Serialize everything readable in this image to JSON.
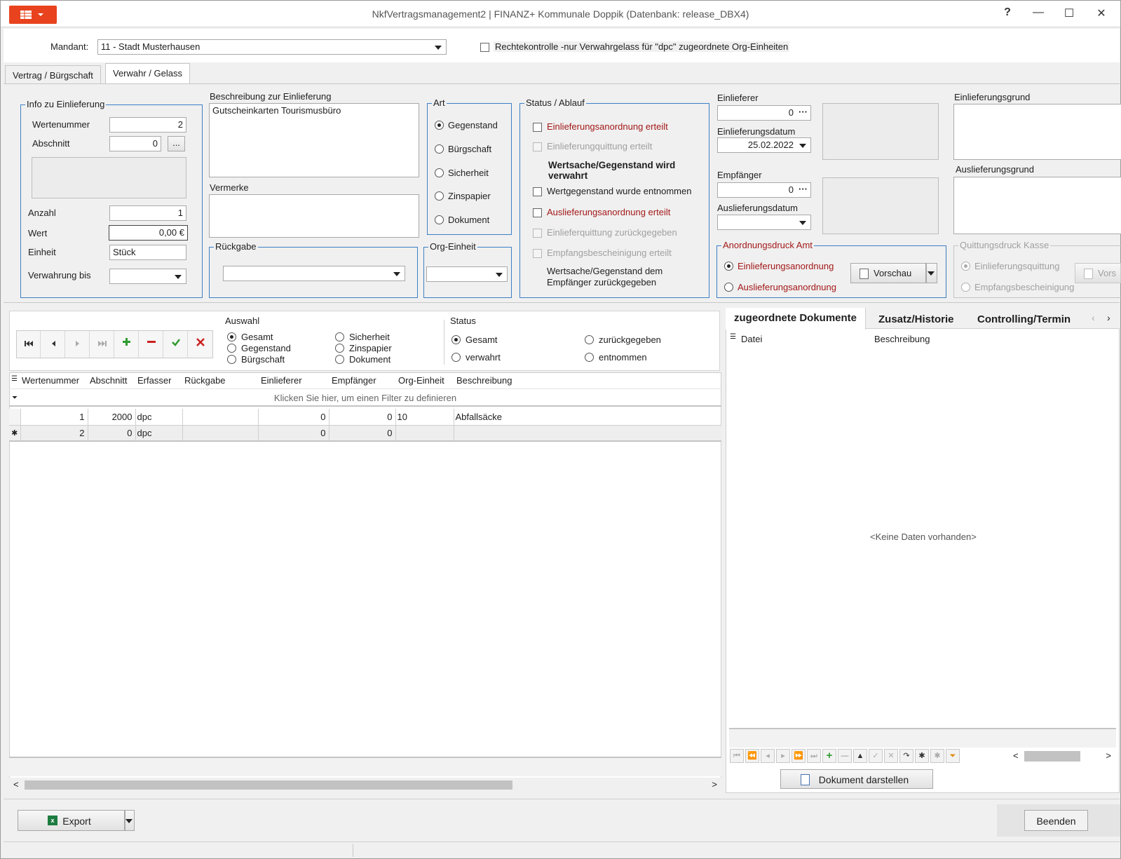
{
  "window": {
    "title": "NkfVertragsmanagement2 | FINANZ+ Kommunale Doppik (Datenbank: release_DBX4)",
    "help": "?",
    "minimize": "—",
    "maximize": "☐",
    "close": "✕"
  },
  "mandant": {
    "label": "Mandant:",
    "value": "11 - Stadt Musterhausen",
    "rechtekontrolle": "Rechtekontrolle  -nur Verwahrgelass für \"dpc\" zugeordnete Org-Einheiten"
  },
  "tabs": [
    "Vertrag / Bürgschaft",
    "Verwahr / Gelass"
  ],
  "info": {
    "title": "Info zu Einlieferung",
    "wertenummer_label": "Wertenummer",
    "wertenummer": "2",
    "abschnitt_label": "Abschnitt",
    "abschnitt": "0",
    "ellipsis": "...",
    "anzahl_label": "Anzahl",
    "anzahl": "1",
    "wert_label": "Wert",
    "wert": "0,00 €",
    "einheit_label": "Einheit",
    "einheit": "Stück",
    "verwahrung_label": "Verwahrung bis",
    "verwahrung": ""
  },
  "beschreibung": {
    "label": "Beschreibung zur Einlieferung",
    "value": "Gutscheinkarten Tourismusbüro",
    "vermerke_label": "Vermerke",
    "rueckgabe_label": "Rückgabe",
    "orgeinheit_label": "Org-Einheit"
  },
  "art": {
    "title": "Art",
    "options": [
      "Gegenstand",
      "Bürgschaft",
      "Sicherheit",
      "Zinspapier",
      "Dokument"
    ],
    "selected": "Gegenstand"
  },
  "status_ablauf": {
    "title": "Status / Ablauf",
    "einlieferungsanordnung": "Einlieferungsanordnung erteilt",
    "einlieferungquittung": "Einlieferungquittung erteilt",
    "verwahrt": "Wertsache/Gegenstand wird verwahrt",
    "entnommen": "Wertgegenstand wurde entnommen",
    "auslieferungsanordnung": "Auslieferungsanordnung erteilt",
    "einlieferquittung_zurueck": "Einlieferquittung zurückgegeben",
    "empfangsbescheinigung": "Empfangsbescheinigung erteilt",
    "zurueckgegeben": "Wertsache/Gegenstand dem Empfänger zurückgegeben"
  },
  "einlieferer": {
    "label": "Einlieferer",
    "value": "0",
    "datum_label": "Einlieferungsdatum",
    "datum": "25.02.2022",
    "empfaenger_label": "Empfänger",
    "empfaenger": "0",
    "ausdatum_label": "Auslieferungsdatum",
    "ausdatum": "",
    "einlieferungsgrund_label": "Einlieferungsgrund",
    "auslieferungsgrund_label": "Auslieferungsgrund",
    "dots": "···"
  },
  "anordnungsdruck": {
    "title": "Anordnungsdruck Amt",
    "einlieferung": "Einlieferungsanordnung",
    "auslieferung": "Auslieferungsanordnung",
    "vorschau": "Vorschau"
  },
  "quittungsdruck": {
    "title": "Quittungsdruck Kasse",
    "einlieferung": "Einlieferungsquittung",
    "empfang": "Empfangsbescheinigung",
    "vorschau": "Vors"
  },
  "filter": {
    "auswahl_label": "Auswahl",
    "auswahl_options": [
      "Gesamt",
      "Gegenstand",
      "Bürgschaft",
      "Sicherheit",
      "Zinspapier",
      "Dokument"
    ],
    "status_label": "Status",
    "status_options": [
      "Gesamt",
      "verwahrt",
      "zurückgegeben",
      "entnommen"
    ]
  },
  "nav_icons": [
    "first",
    "prev",
    "next",
    "last",
    "add",
    "remove",
    "confirm",
    "cancel"
  ],
  "grid": {
    "columns": [
      "Wertenummer",
      "Abschnitt",
      "Erfasser",
      "Rückgabe",
      "Einlieferer",
      "Empfänger",
      "Org-Einheit",
      "Beschreibung"
    ],
    "filter_hint": "Klicken Sie hier, um einen Filter zu definieren",
    "rows": [
      [
        "1",
        "2000",
        "dpc",
        "",
        "0",
        "0",
        "10",
        "Abfallsäcke"
      ],
      [
        "2",
        "0",
        "dpc",
        "",
        "0",
        "0",
        "",
        ""
      ]
    ]
  },
  "right_panel": {
    "tabs": [
      "zugeordnete Dokumente",
      "Zusatz/Historie",
      "Controlling/Termin"
    ],
    "col_datei": "Datei",
    "col_beschreibung": "Beschreibung",
    "empty": "<Keine Daten vorhanden>",
    "dokument_button": "Dokument darstellen"
  },
  "footer": {
    "export": "Export",
    "beenden": "Beenden"
  },
  "colors": {
    "accent": "#e8431e",
    "groupborder": "#3c7fc6",
    "redtext": "#a31818"
  }
}
